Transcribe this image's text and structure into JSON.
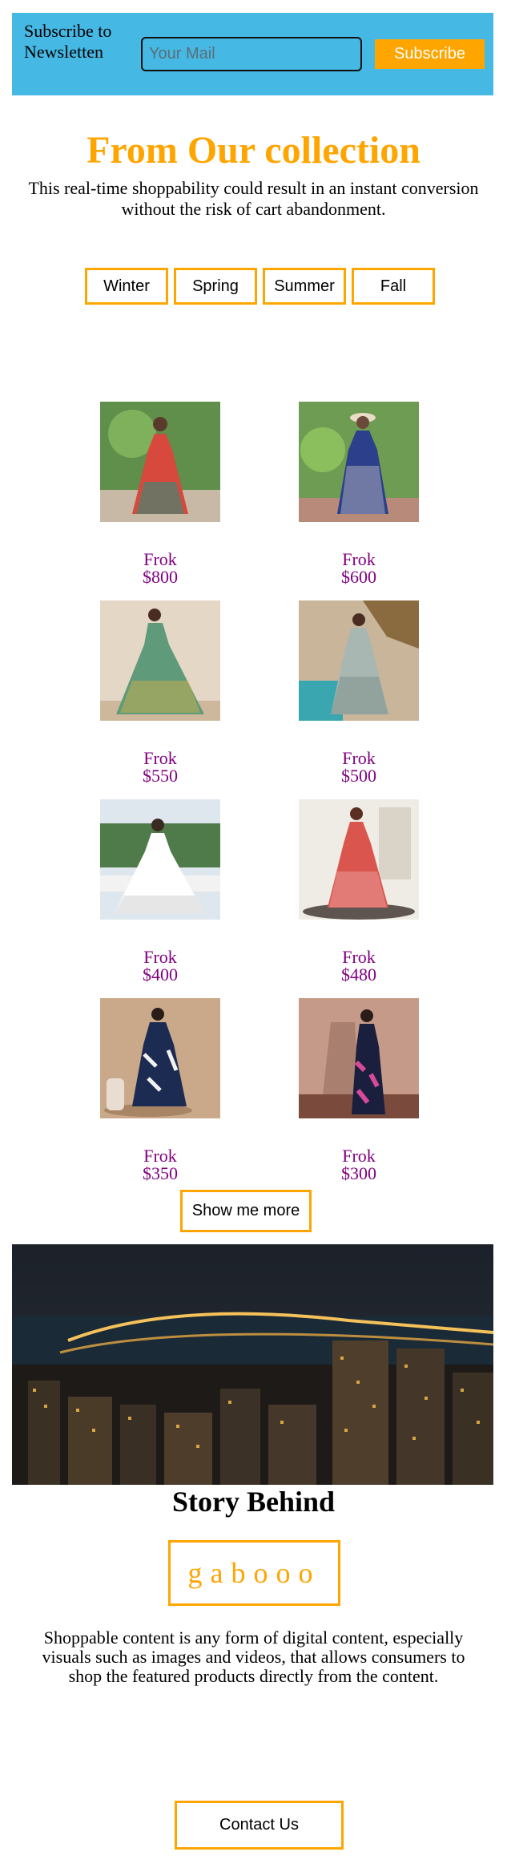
{
  "newsletter": {
    "label": "Subscribe to Newsletten",
    "input_placeholder": "Your Mail",
    "input_value": "",
    "button_label": "Subscribe"
  },
  "collection": {
    "title": "From Our collection",
    "description": "This real-time shoppability could result in an instant conversion without the risk of cart abandonment."
  },
  "seasons": [
    "Winter",
    "Spring",
    "Summer",
    "Fall"
  ],
  "products": [
    {
      "name": "Frok",
      "price": "$800"
    },
    {
      "name": "Frok",
      "price": "$600"
    },
    {
      "name": "Frok",
      "price": "$550"
    },
    {
      "name": "Frok",
      "price": "$500"
    },
    {
      "name": "Frok",
      "price": "$400"
    },
    {
      "name": "Frok",
      "price": "$480"
    },
    {
      "name": "Frok",
      "price": "$350"
    },
    {
      "name": "Frok",
      "price": "$300"
    }
  ],
  "show_more_label": "Show me more",
  "story": {
    "title": "Story Behind",
    "brand": "gabooo",
    "text": "Shoppable content is any form of digital content, especially visuals such as images and videos, that allows consumers to shop the featured products directly from the content."
  },
  "contact_label": "Contact Us",
  "colors": {
    "accent": "#ffa500",
    "newsletter_bg": "#45b8e4",
    "product_text": "#800080"
  }
}
